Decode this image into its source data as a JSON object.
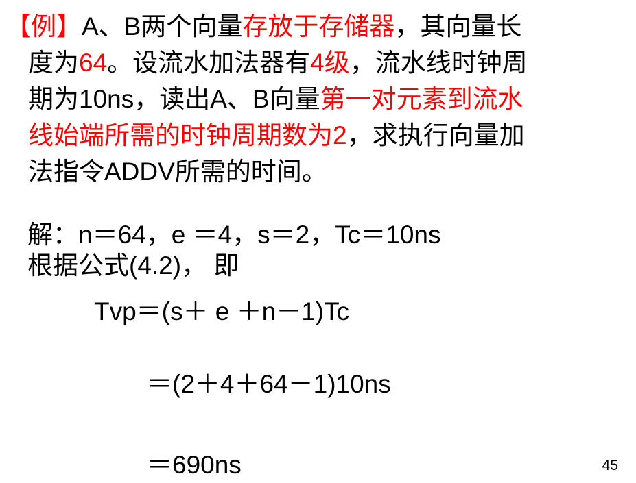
{
  "problem": {
    "lines": [
      [
        {
          "t": "【例】",
          "red": true
        },
        {
          "t": "A、B两个向量",
          "red": false
        },
        {
          "t": "存放于存储器",
          "red": true
        },
        {
          "t": "，其向量长",
          "red": false
        }
      ],
      [
        {
          "t": "度为",
          "red": false
        },
        {
          "t": "64",
          "red": true
        },
        {
          "t": "。设流水加法器有",
          "red": false
        },
        {
          "t": "4级",
          "red": true
        },
        {
          "t": "，流水线时钟周",
          "red": false
        }
      ],
      [
        {
          "t": "期为10ns，读出A、B向量",
          "red": false
        },
        {
          "t": "第一对元素到流水",
          "red": true
        }
      ],
      [
        {
          "t": "线始端所需的时钟周期数为2",
          "red": true
        },
        {
          "t": "，求执行向量加",
          "red": false
        }
      ],
      [
        {
          "t": "法指令ADDV所需的时间。",
          "red": false
        }
      ]
    ]
  },
  "solution": {
    "line1": "解：n＝64，e ＝4，s＝2，Tc＝10ns",
    "line2": "根据公式(4.2)， 即",
    "formula": "Tvp＝(s＋ e ＋n－1)Tc",
    "step1": "＝(2＋4＋64－1)10ns",
    "step2": "＝690ns"
  },
  "page_number": "45"
}
